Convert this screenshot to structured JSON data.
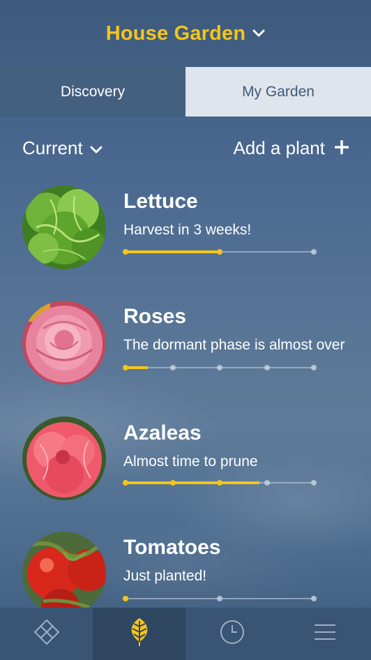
{
  "header": {
    "title": "House Garden",
    "dropdown_icon": "chevron-down-icon"
  },
  "tabs": [
    {
      "label": "Discovery",
      "active": false
    },
    {
      "label": "My Garden",
      "active": true
    }
  ],
  "toolbar": {
    "filter_label": "Current",
    "filter_icon": "chevron-down-icon",
    "add_label": "Add a plant",
    "add_icon": "plus-icon"
  },
  "plants": [
    {
      "name": "Lettuce",
      "status": "Harvest in 3 weeks!",
      "stages": 3,
      "progress": 0.5,
      "image": "lettuce-photo"
    },
    {
      "name": "Roses",
      "status": "The dormant phase is almost over",
      "stages": 5,
      "progress": 0.12,
      "image": "rose-photo"
    },
    {
      "name": "Azaleas",
      "status": "Almost time to prune",
      "stages": 5,
      "progress": 0.71,
      "image": "azalea-photo"
    },
    {
      "name": "Tomatoes",
      "status": "Just planted!",
      "stages": 3,
      "progress": 0.0,
      "image": "tomato-photo"
    }
  ],
  "bottom_nav": [
    {
      "icon": "diamond-grid-icon",
      "active": false
    },
    {
      "icon": "leaf-icon",
      "active": true
    },
    {
      "icon": "clock-icon",
      "active": false
    },
    {
      "icon": "menu-icon",
      "active": false
    }
  ],
  "colors": {
    "accent": "#f5c518",
    "background": "#4a6890",
    "tab_active_bg": "#dfe5ec",
    "nav_bg": "#3a5473"
  }
}
